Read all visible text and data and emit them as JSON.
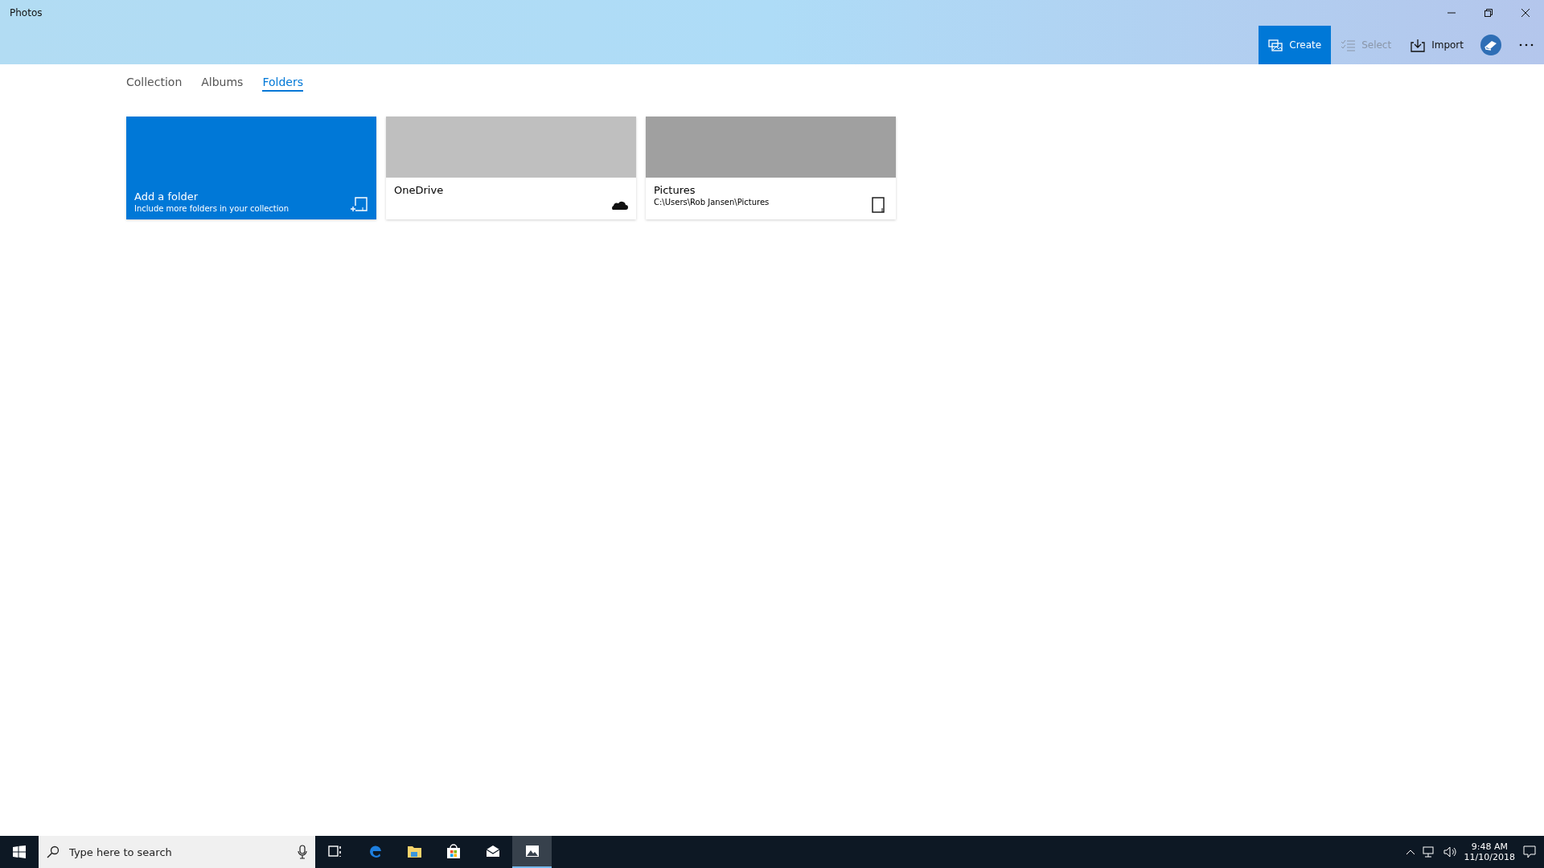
{
  "window": {
    "title": "Photos"
  },
  "toolbar": [
    {
      "kind": "create",
      "label": "Create",
      "selected": true,
      "disabled": false
    },
    {
      "kind": "select",
      "label": "Select",
      "selected": false,
      "disabled": true
    },
    {
      "kind": "import",
      "label": "Import",
      "selected": false,
      "disabled": false
    }
  ],
  "tabs": [
    {
      "label": "Collection",
      "selected": false
    },
    {
      "label": "Albums",
      "selected": false
    },
    {
      "label": "Folders",
      "selected": true
    }
  ],
  "folders": [
    {
      "kind": "add",
      "title": "Add a folder",
      "subtitle": "Include more folders in your collection"
    },
    {
      "kind": "onedrive",
      "title": "OneDrive"
    },
    {
      "kind": "local",
      "title": "Pictures",
      "subtitle": "C:\\Users\\Rob Jansen\\Pictures"
    }
  ],
  "taskbar": {
    "search": {
      "placeholder": "Type here to search"
    },
    "apps": [
      {
        "kind": "taskview",
        "selected": false
      },
      {
        "kind": "edge",
        "selected": false
      },
      {
        "kind": "explorer",
        "selected": false
      },
      {
        "kind": "store",
        "selected": false
      },
      {
        "kind": "mail",
        "selected": false
      },
      {
        "kind": "photos",
        "selected": true
      }
    ],
    "time": "9:48 AM",
    "date": "11/10/2018"
  }
}
